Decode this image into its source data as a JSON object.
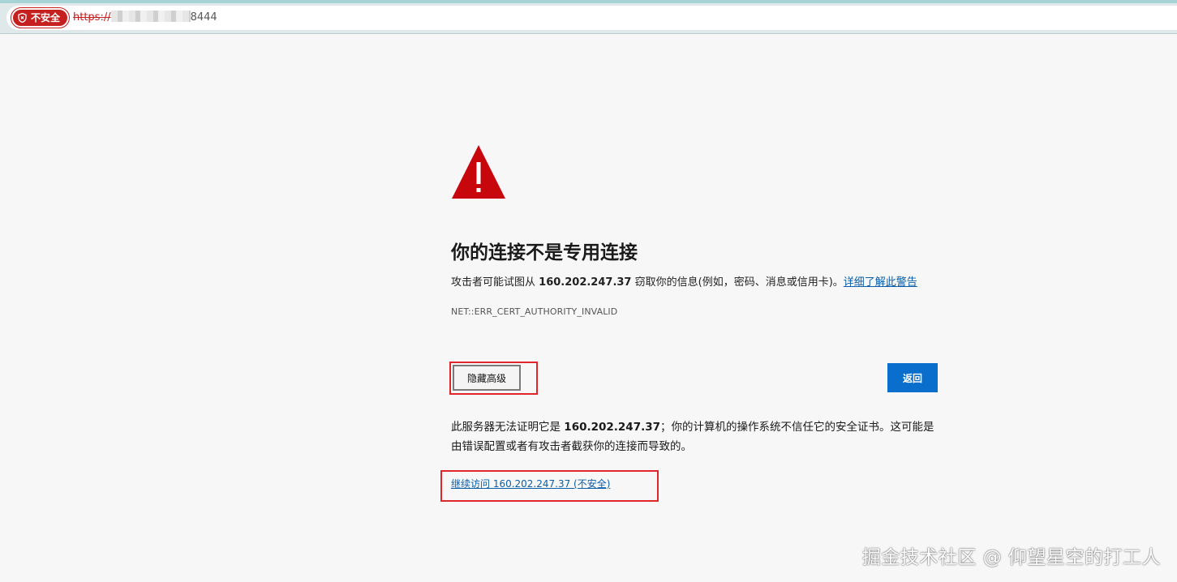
{
  "browser": {
    "security_badge": "不安全",
    "url_protocol": "https://",
    "url_port": "8444"
  },
  "main": {
    "title": "你的连接不是专用连接",
    "description_prefix": "攻击者可能试图从",
    "host": "160.202.247.37",
    "description_suffix": "窃取你的信息(例如，密码、消息或信用卡)。",
    "learn_more_link": "详细了解此警告",
    "error_code": "NET::ERR_CERT_AUTHORITY_INVALID",
    "hide_advanced_button": "隐藏高级",
    "back_button": "返回",
    "explanation_prefix": "此服务器无法证明它是",
    "explanation_suffix": "；你的计算机的操作系统不信任它的安全证书。这可能是由错误配置或者有攻击者截获你的连接而导致的。",
    "proceed_link": "继续访问 160.202.247.37 (不安全)"
  },
  "watermark": "掘金技术社区 @ 仰望星空的打工人",
  "colors": {
    "danger": "#c5201f",
    "primary_button": "#0a6ecc",
    "link": "#0b5ea8",
    "annotation": "#e0262b"
  },
  "icons": {
    "security_badge": "shield-icon",
    "warning": "warning-triangle-icon"
  }
}
